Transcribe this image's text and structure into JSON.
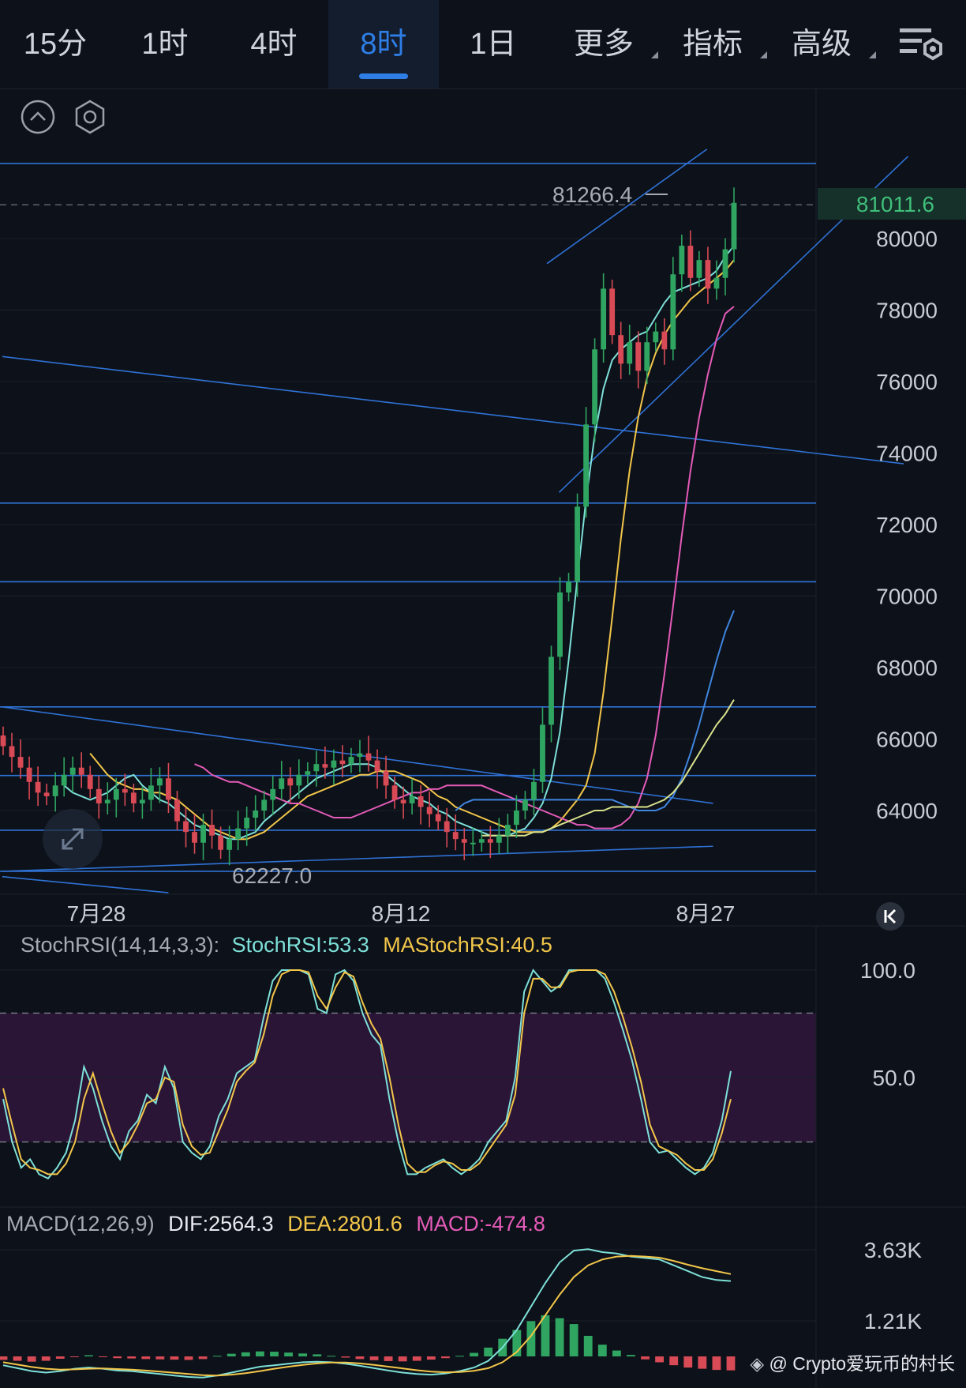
{
  "tabs": [
    {
      "label": "15分",
      "active": false
    },
    {
      "label": "1时",
      "active": false
    },
    {
      "label": "4时",
      "active": false
    },
    {
      "label": "8时",
      "active": true
    },
    {
      "label": "1日",
      "active": false
    },
    {
      "label": "更多",
      "active": false,
      "dropdown": true
    },
    {
      "label": "指标",
      "active": false,
      "dropdown": true
    },
    {
      "label": "高级",
      "active": false,
      "dropdown": true
    }
  ],
  "icons": {
    "settings": "chart-settings-icon",
    "collapse": "collapse-up-icon",
    "hexagon": "hexagon-settings-icon",
    "expand": "expand-arrows-icon",
    "scroll_end": "scroll-to-latest-icon"
  },
  "colors": {
    "background": "#0d1119",
    "accent": "#2e7ee6",
    "up": "#2fa561",
    "down": "#d84a55",
    "ma_cyan": "#7de0d8",
    "ma_yellow": "#f2c64a",
    "ma_pink": "#e45bb8",
    "ma_blue": "#3f86e0",
    "ma_lightyellow": "#d8e28c",
    "trendline": "#2f72d6",
    "price_tag_bg": "#16302a",
    "price_tag_text": "#3fbf7a",
    "stoch_zone": "#2a1536"
  },
  "main": {
    "high_label": "81266.4",
    "low_label": "62227.0",
    "current_price": "81011.6",
    "watermark": "@ Crypto爱玩币的村长"
  },
  "stoch": {
    "name": "StochRSI(14,14,3,3):",
    "k_label": "StochRSI:53.3",
    "d_label": "MAStochRSI:40.5"
  },
  "macd": {
    "name": "MACD(12,26,9)",
    "dif_label": "DIF:2564.3",
    "dea_label": "DEA:2801.6",
    "hist_label": "MACD:-474.8"
  },
  "chart_data": [
    {
      "type": "candlestick",
      "timeframe": "8时",
      "price_axis": {
        "range": [
          62000,
          81500
        ],
        "ticks": [
          "80000",
          "78000",
          "76000",
          "74000",
          "72000",
          "70000",
          "68000",
          "66000",
          "64000"
        ]
      },
      "time_axis": {
        "ticks": [
          "7月28",
          "8月12",
          "8月27"
        ]
      },
      "annotations": {
        "high": 81266.4,
        "low": 62227.0,
        "last": 81011.6
      },
      "close_path": [
        65800,
        65500,
        65200,
        64800,
        64500,
        64400,
        64700,
        65000,
        65200,
        65000,
        64600,
        64200,
        64300,
        64600,
        64500,
        64200,
        64300,
        64700,
        64900,
        64300,
        63700,
        63400,
        63100,
        63600,
        63300,
        62900,
        63200,
        63500,
        63800,
        64000,
        64300,
        64600,
        64900,
        64700,
        65000,
        65100,
        65300,
        65200,
        65400,
        65300,
        65500,
        65600,
        65400,
        65100,
        64700,
        64300,
        64200,
        64400,
        64100,
        63900,
        63700,
        63400,
        63200,
        63100,
        63100,
        63200,
        63100,
        63300,
        63600,
        64000,
        64300,
        64800,
        66400,
        68300,
        70100,
        70400,
        72500,
        74800,
        76900,
        78600,
        77300,
        76500,
        77100,
        76300,
        77100,
        77400,
        76900,
        79000,
        79800,
        78900,
        79400,
        78600,
        78900,
        79700,
        81000
      ],
      "moving_averages": [
        {
          "color": "cyan",
          "path": [
            64700,
            64500,
            64400,
            64300,
            64400,
            64500,
            64700,
            64900,
            65000,
            64700,
            64500,
            64300,
            64200,
            64000,
            63800,
            63600,
            63500,
            63400,
            63300,
            63200,
            63200,
            63300,
            63400,
            63700,
            63900,
            64100,
            64300,
            64500,
            64700,
            64900,
            65000,
            65100,
            65200,
            65300,
            65300,
            65300,
            65200,
            65000,
            64800,
            64600,
            64400,
            64300,
            64200,
            64000,
            63900,
            63700,
            63600,
            63500,
            63400,
            63300,
            63300,
            63300,
            63400,
            63500,
            63800,
            64200,
            64900,
            66200,
            68200,
            70500,
            72700,
            74500,
            75800,
            76600,
            76900,
            77100,
            77300,
            77400,
            77800,
            78200,
            78500,
            78600,
            78700,
            78800,
            78900,
            79100,
            79500,
            79800
          ]
        },
        {
          "color": "yellow",
          "path": [
            65600,
            65300,
            65000,
            64800,
            64700,
            64600,
            64600,
            64500,
            64500,
            64400,
            64300,
            64100,
            63900,
            63700,
            63500,
            63400,
            63300,
            63200,
            63200,
            63300,
            63400,
            63600,
            63800,
            64000,
            64200,
            64400,
            64500,
            64600,
            64700,
            64800,
            64900,
            65000,
            65000,
            65100,
            65100,
            65100,
            65000,
            64900,
            64800,
            64600,
            64400,
            64300,
            64100,
            64000,
            63900,
            63800,
            63700,
            63600,
            63500,
            63400,
            63400,
            63400,
            63400,
            63500,
            63700,
            64000,
            64300,
            64700,
            65600,
            67300,
            69400,
            71600,
            73500,
            75000,
            76100,
            76800,
            77300,
            77700,
            78000,
            78300,
            78500,
            78700,
            78900,
            79100,
            79400
          ]
        },
        {
          "color": "pink",
          "path": [
            65300,
            65200,
            65000,
            64900,
            64800,
            64800,
            64700,
            64600,
            64500,
            64400,
            64300,
            64200,
            64200,
            64100,
            64000,
            63900,
            63800,
            63800,
            63800,
            63900,
            64000,
            64100,
            64200,
            64300,
            64400,
            64500,
            64500,
            64600,
            64600,
            64700,
            64700,
            64700,
            64700,
            64700,
            64600,
            64500,
            64400,
            64300,
            64200,
            64100,
            64000,
            63900,
            63800,
            63700,
            63600,
            63600,
            63500,
            63500,
            63500,
            63600,
            63800,
            64200,
            64900,
            66100,
            67800,
            69700,
            71700,
            73500,
            75000,
            76200,
            77200,
            77900,
            78100
          ]
        },
        {
          "color": "blue",
          "path": [
            64000,
            64200,
            64300,
            64300,
            64300,
            64300,
            64300,
            64300,
            64300,
            64300,
            64300,
            64300,
            64300,
            64300,
            64300,
            64300,
            64300,
            64300,
            64300,
            64200,
            64100,
            64000,
            64000,
            64000,
            64100,
            64400,
            64900,
            65600,
            66400,
            67300,
            68200,
            69000,
            69600
          ]
        },
        {
          "color": "lightyellow",
          "path": [
            63300,
            63300,
            63300,
            63300,
            63300,
            63300,
            63400,
            63400,
            63500,
            63600,
            63700,
            63800,
            63900,
            64000,
            64000,
            64100,
            64100,
            64100,
            64100,
            64100,
            64200,
            64300,
            64500,
            64800,
            65200,
            65600,
            66000,
            66400,
            66700,
            67100
          ]
        }
      ]
    },
    {
      "type": "line",
      "title": "StochRSI(14,14,3,3)",
      "y_ticks": [
        "100.0",
        "50.0"
      ],
      "ylim": [
        0,
        100
      ],
      "overbought": 80,
      "oversold": 20,
      "series": [
        {
          "name": "StochRSI",
          "color": "cyan",
          "values": [
            40,
            20,
            8,
            12,
            5,
            3,
            8,
            15,
            30,
            55,
            45,
            30,
            18,
            12,
            25,
            30,
            42,
            38,
            55,
            45,
            20,
            15,
            12,
            18,
            32,
            40,
            52,
            55,
            58,
            78,
            95,
            100,
            100,
            100,
            98,
            82,
            80,
            98,
            100,
            95,
            80,
            70,
            65,
            40,
            20,
            5,
            5,
            8,
            10,
            12,
            8,
            5,
            8,
            12,
            20,
            25,
            30,
            50,
            90,
            100,
            95,
            90,
            93,
            100,
            100,
            100,
            100,
            96,
            85,
            72,
            58,
            40,
            20,
            15,
            16,
            12,
            8,
            5,
            8,
            15,
            30,
            53
          ]
        },
        {
          "name": "MAStochRSI",
          "color": "yellow",
          "values": [
            45,
            28,
            12,
            8,
            7,
            5,
            5,
            10,
            20,
            40,
            52,
            38,
            25,
            15,
            20,
            28,
            38,
            40,
            50,
            48,
            28,
            18,
            14,
            15,
            25,
            35,
            48,
            53,
            57,
            70,
            88,
            98,
            100,
            100,
            99,
            88,
            82,
            92,
            99,
            97,
            85,
            75,
            68,
            50,
            28,
            10,
            6,
            6,
            9,
            11,
            10,
            7,
            7,
            10,
            16,
            22,
            28,
            42,
            80,
            96,
            96,
            92,
            92,
            99,
            100,
            100,
            100,
            98,
            90,
            78,
            64,
            48,
            28,
            18,
            16,
            14,
            10,
            7,
            7,
            12,
            24,
            40
          ]
        }
      ]
    },
    {
      "type": "bar",
      "title": "MACD(12,26,9)",
      "y_ticks": [
        "3.63K",
        "1.21K"
      ],
      "series": [
        {
          "name": "DIF",
          "color": "cyan",
          "values": [
            -300,
            -400,
            -500,
            -550,
            -500,
            -420,
            -380,
            -420,
            -480,
            -500,
            -550,
            -600,
            -650,
            -700,
            -720,
            -650,
            -550,
            -450,
            -350,
            -300,
            -250,
            -200,
            -180,
            -200,
            -250,
            -320,
            -400,
            -480,
            -550,
            -600,
            -620,
            -580,
            -500,
            -380,
            -150,
            300,
            900,
            1700,
            2500,
            3200,
            3600,
            3650,
            3550,
            3500,
            3400,
            3350,
            3300,
            3100,
            2900,
            2700,
            2600,
            2564
          ]
        },
        {
          "name": "DEA",
          "color": "yellow",
          "values": [
            -200,
            -280,
            -360,
            -420,
            -450,
            -440,
            -420,
            -410,
            -430,
            -450,
            -480,
            -520,
            -560,
            -600,
            -640,
            -650,
            -620,
            -570,
            -500,
            -420,
            -350,
            -290,
            -240,
            -210,
            -210,
            -240,
            -290,
            -350,
            -410,
            -470,
            -520,
            -540,
            -530,
            -490,
            -400,
            -200,
            150,
            700,
            1400,
            2100,
            2700,
            3100,
            3300,
            3400,
            3420,
            3400,
            3360,
            3250,
            3120,
            3000,
            2900,
            2802
          ]
        },
        {
          "name": "MACD",
          "color": "mixed",
          "values": [
            -120,
            -150,
            -180,
            -150,
            -80,
            -20,
            40,
            -10,
            -60,
            -70,
            -90,
            -100,
            -110,
            -120,
            -90,
            20,
            90,
            140,
            170,
            160,
            130,
            100,
            70,
            20,
            -40,
            -90,
            -130,
            -160,
            -170,
            -150,
            -110,
            -60,
            20,
            120,
            300,
            600,
            900,
            1200,
            1400,
            1300,
            1100,
            700,
            400,
            200,
            50,
            -100,
            -200,
            -300,
            -380,
            -420,
            -460,
            -475
          ]
        }
      ]
    }
  ]
}
